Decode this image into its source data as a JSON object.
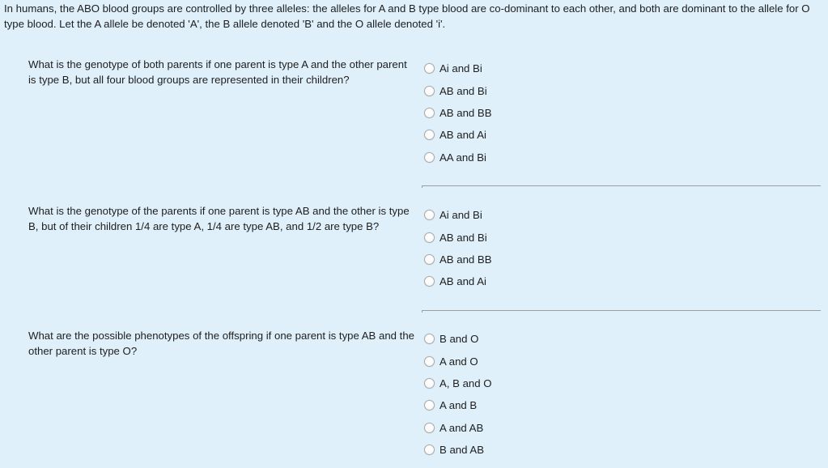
{
  "intro": "In humans, the ABO blood groups are controlled by three alleles: the alleles for A and B type blood are co-dominant to each other, and both are dominant to the allele for O type blood. Let the A allele be denoted 'A', the B allele denoted 'B' and the O allele denoted 'i'.",
  "questions": [
    {
      "text": "What is the genotype of both parents if one parent is type A and the other parent is type B, but all four blood groups are represented in their children?",
      "options": [
        "Ai and Bi",
        "AB and Bi",
        "AB and BB",
        "AB and Ai",
        "AA and Bi"
      ]
    },
    {
      "text": "What is the genotype of the parents if one parent is type AB and the other is type B, but of their children 1/4 are type A, 1/4 are type AB, and 1/2 are type B?",
      "options": [
        "Ai and Bi",
        "AB and Bi",
        "AB and BB",
        "AB and Ai"
      ]
    },
    {
      "text": "What are the possible phenotypes of the offspring if one parent is type AB and the other parent is type O?",
      "options": [
        "B and O",
        "A and O",
        "A, B and O",
        "A and B",
        "A and AB",
        "B and AB"
      ]
    }
  ]
}
